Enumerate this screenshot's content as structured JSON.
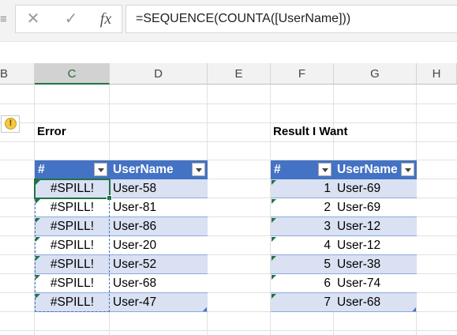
{
  "formula_bar": {
    "namebox_fragment": "≡",
    "cancel_icon": "✕",
    "enter_icon": "✓",
    "fx_label": "fx",
    "formula": "=SEQUENCE(COUNTA([UserName]))"
  },
  "columns": [
    "B",
    "C",
    "D",
    "E",
    "F",
    "G",
    "H"
  ],
  "active_column": "C",
  "labels": {
    "error": "Error",
    "result": "Result I Want"
  },
  "warning_icon": "!",
  "error_table": {
    "headers": [
      "#",
      "UserName"
    ],
    "rows": [
      {
        "num": "#SPILL!",
        "user": "User-58"
      },
      {
        "num": "#SPILL!",
        "user": "User-81"
      },
      {
        "num": "#SPILL!",
        "user": "User-86"
      },
      {
        "num": "#SPILL!",
        "user": "User-20"
      },
      {
        "num": "#SPILL!",
        "user": "User-52"
      },
      {
        "num": "#SPILL!",
        "user": "User-68"
      },
      {
        "num": "#SPILL!",
        "user": "User-47"
      }
    ]
  },
  "result_table": {
    "headers": [
      "#",
      "UserName"
    ],
    "rows": [
      {
        "num": "1",
        "user": "User-69"
      },
      {
        "num": "2",
        "user": "User-69"
      },
      {
        "num": "3",
        "user": "User-12"
      },
      {
        "num": "4",
        "user": "User-12"
      },
      {
        "num": "5",
        "user": "User-38"
      },
      {
        "num": "6",
        "user": "User-74"
      },
      {
        "num": "7",
        "user": "User-68"
      }
    ]
  },
  "colors": {
    "table_header": "#4472c4",
    "band": "#d9e1f2",
    "excel_green": "#217346"
  }
}
